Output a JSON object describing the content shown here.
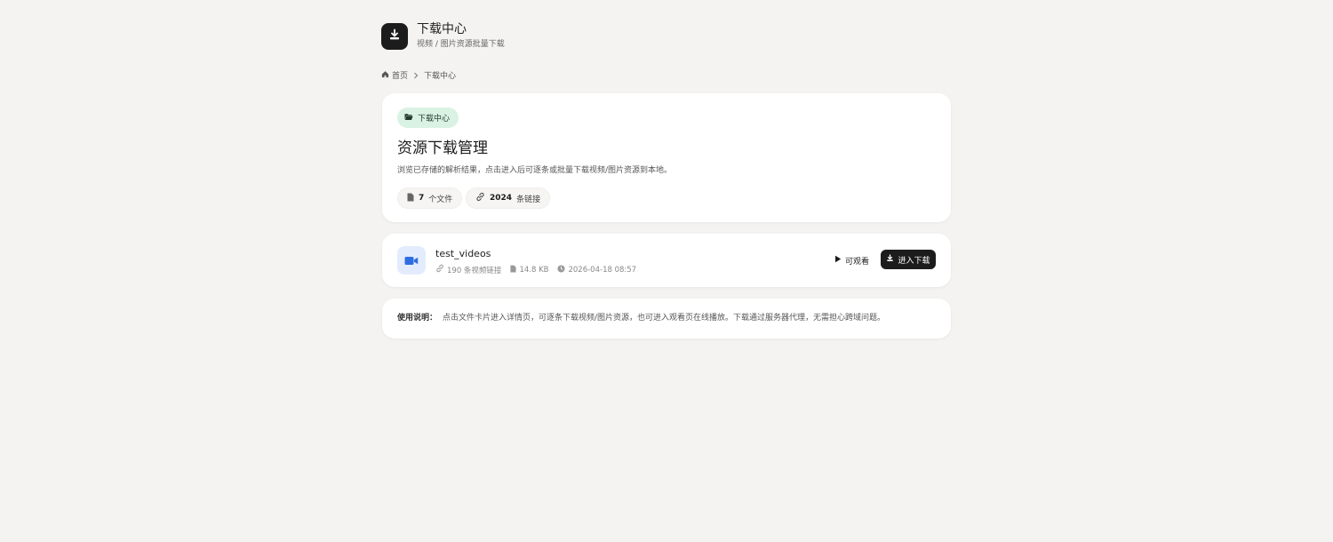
{
  "app": {
    "title": "下载中心",
    "subtitle": "视频 / 图片资源批量下载"
  },
  "breadcrumb": {
    "home": "首页",
    "current": "下载中心"
  },
  "hero": {
    "tag": "下载中心",
    "title": "资源下载管理",
    "description": "浏览已存储的解析结果，点击进入后可逐条或批量下载视频/图片资源到本地。",
    "stats": {
      "files_count": "7",
      "files_label": "个文件",
      "links_count": "2024",
      "links_label": "条链接"
    }
  },
  "files": [
    {
      "name": "test_videos",
      "links": "190 条视频链接",
      "size": "14.8 KB",
      "date": "2026-04-18 08:57",
      "watch_label": "可观看",
      "download_label": "进入下载"
    }
  ],
  "help": {
    "label": "使用说明：",
    "text": "点击文件卡片进入详情页，可逐条下载视频/图片资源，也可进入观看页在线播放。下载通过服务器代理，无需担心跨域问题。"
  },
  "colors": {
    "background": "#f4f3f1",
    "accent_dark": "#1c1c1c",
    "tag_bg": "#d9f2e3",
    "video_icon": "#2f6ee0",
    "video_icon_bg": "#e3ecfc"
  },
  "icons": {
    "logo": "download-icon",
    "home": "home-icon",
    "chevron": "chevron-right-icon",
    "folder": "folder-open-icon",
    "file": "file-icon",
    "link": "link-icon",
    "video": "video-camera-icon",
    "clock": "clock-icon",
    "play": "play-icon",
    "download": "download-icon"
  }
}
